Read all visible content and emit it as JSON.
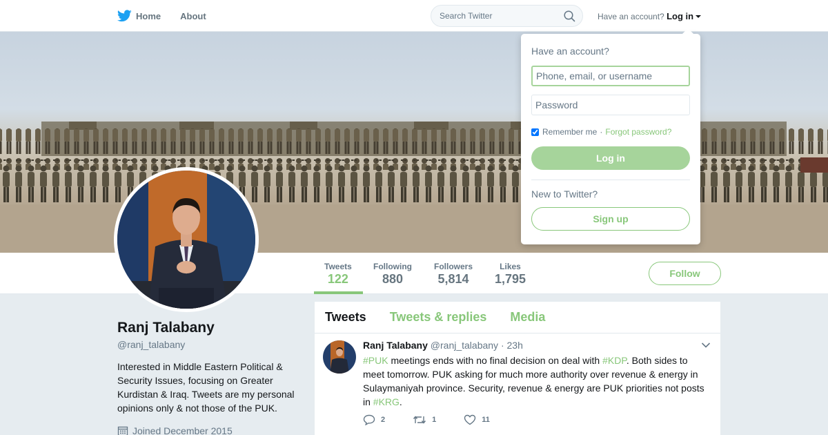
{
  "nav": {
    "home_label": "Home",
    "about_label": "About",
    "search_placeholder": "Search Twitter",
    "have_account_text": "Have an account?",
    "login_label": "Log in"
  },
  "profile": {
    "name": "Ranj Talabany",
    "handle": "@ranj_talabany",
    "bio": "Interested in Middle Eastern Political & Security Issues, focusing on Greater Kurdistan & Iraq. Tweets are my personal opinions only & not those of the PUK.",
    "joined": "Joined December 2015"
  },
  "stats": [
    {
      "label": "Tweets",
      "value": "122"
    },
    {
      "label": "Following",
      "value": "880"
    },
    {
      "label": "Followers",
      "value": "5,814"
    },
    {
      "label": "Likes",
      "value": "1,795"
    }
  ],
  "follow_label": "Follow",
  "timeline": {
    "tabs": [
      "Tweets",
      "Tweets & replies",
      "Media"
    ],
    "tweet": {
      "author": "Ranj Talabany",
      "handle": "@ranj_talabany",
      "separator": "·",
      "time": "23h",
      "text_parts": [
        {
          "text": "#PUK",
          "hashtag": true
        },
        {
          "text": " meetings ends with no final decision on deal with ",
          "hashtag": false
        },
        {
          "text": "#KDP",
          "hashtag": true
        },
        {
          "text": ". Both sides to meet tomorrow. PUK asking for much more authority over revenue & energy in Sulaymaniyah province. Security, revenue & energy are PUK priorities not posts in ",
          "hashtag": false
        },
        {
          "text": "#KRG",
          "hashtag": true
        },
        {
          "text": ".",
          "hashtag": false
        }
      ],
      "replies": "2",
      "retweets": "1",
      "likes": "11"
    }
  },
  "login_dropdown": {
    "title": "Have an account?",
    "username_placeholder": "Phone, email, or username",
    "password_placeholder": "Password",
    "remember_label": "Remember me",
    "separator": "·",
    "forgot_label": "Forgot password?",
    "login_button": "Log in",
    "new_text": "New to Twitter?",
    "signup_button": "Sign up"
  },
  "colors": {
    "accent": "#88c77a",
    "accent_light": "#a6d49b",
    "twitter_blue": "#1da1f2",
    "text_secondary": "#657786"
  },
  "icons": [
    "twitter-bird-icon",
    "home-icon",
    "search-icon",
    "caret-down-icon",
    "calendar-icon",
    "reply-icon",
    "retweet-icon",
    "like-icon",
    "chevron-down-icon"
  ]
}
